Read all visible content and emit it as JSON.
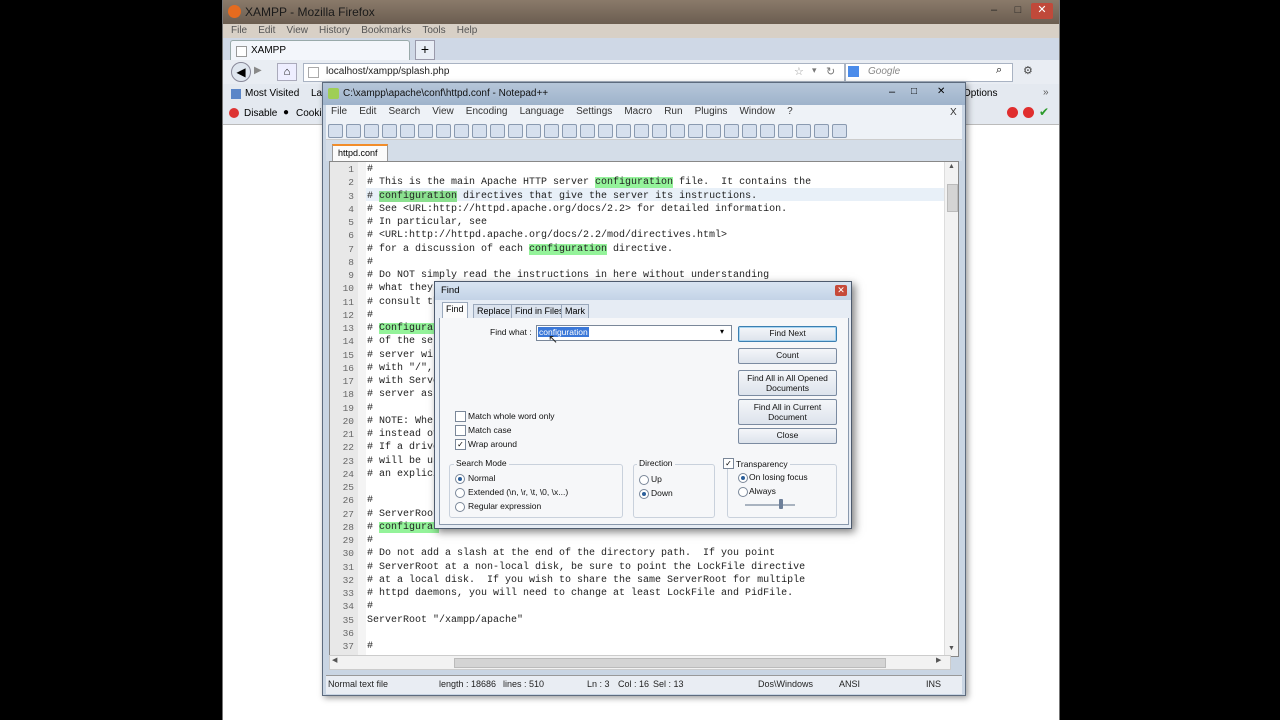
{
  "firefox": {
    "title": "XAMPP - Mozilla Firefox",
    "menu": [
      "File",
      "Edit",
      "View",
      "History",
      "Bookmarks",
      "Tools",
      "Help"
    ],
    "tab_label": "XAMPP",
    "new_tab_label": "+",
    "url": "localhost/xampp/splash.php",
    "search_placeholder": "Google",
    "bookmarks": [
      "Most Visited",
      "La"
    ],
    "addon_items": [
      "Disable",
      "Cooki"
    ],
    "addon_right": "Options"
  },
  "npp": {
    "title": "C:\\xampp\\apache\\conf\\httpd.conf - Notepad++",
    "menu": [
      "File",
      "Edit",
      "Search",
      "View",
      "Encoding",
      "Language",
      "Settings",
      "Macro",
      "Run",
      "Plugins",
      "Window",
      "?"
    ],
    "close_doc": "X",
    "tab_label": "httpd.conf",
    "lines": [
      {
        "n": "1",
        "t": "#"
      },
      {
        "n": "2",
        "t": "# This is the main Apache HTTP server configuration file.  It contains the"
      },
      {
        "n": "3",
        "t": "# configuration directives that give the server its instructions."
      },
      {
        "n": "4",
        "t": "# See <URL:http://httpd.apache.org/docs/2.2> for detailed information."
      },
      {
        "n": "5",
        "t": "# In particular, see"
      },
      {
        "n": "6",
        "t": "# <URL:http://httpd.apache.org/docs/2.2/mod/directives.html>"
      },
      {
        "n": "7",
        "t": "# for a discussion of each configuration directive."
      },
      {
        "n": "8",
        "t": "#"
      },
      {
        "n": "9",
        "t": "# Do NOT simply read the instructions in here without understanding"
      },
      {
        "n": "10",
        "t": "# what they"
      },
      {
        "n": "11",
        "t": "# consult th"
      },
      {
        "n": "12",
        "t": "#"
      },
      {
        "n": "13",
        "t": "# Configurat"
      },
      {
        "n": "14",
        "t": "# of the ser"
      },
      {
        "n": "15",
        "t": "# server wil"
      },
      {
        "n": "16",
        "t": "# with \"/\","
      },
      {
        "n": "17",
        "t": "# with Serve"
      },
      {
        "n": "18",
        "t": "# server as"
      },
      {
        "n": "19",
        "t": "#"
      },
      {
        "n": "20",
        "t": "# NOTE: Wher"
      },
      {
        "n": "21",
        "t": "# instead of"
      },
      {
        "n": "22",
        "t": "# If a drive"
      },
      {
        "n": "23",
        "t": "# will be us"
      },
      {
        "n": "24",
        "t": "# an explici"
      },
      {
        "n": "25",
        "t": ""
      },
      {
        "n": "26",
        "t": "#"
      },
      {
        "n": "27",
        "t": "# ServerRoot"
      },
      {
        "n": "28",
        "t": "# configurat"
      },
      {
        "n": "29",
        "t": "#"
      },
      {
        "n": "30",
        "t": "# Do not add a slash at the end of the directory path.  If you point"
      },
      {
        "n": "31",
        "t": "# ServerRoot at a non-local disk, be sure to point the LockFile directive"
      },
      {
        "n": "32",
        "t": "# at a local disk.  If you wish to share the same ServerRoot for multiple"
      },
      {
        "n": "33",
        "t": "# httpd daemons, you will need to change at least LockFile and PidFile."
      },
      {
        "n": "34",
        "t": "#"
      },
      {
        "n": "35",
        "t": "ServerRoot \"/xampp/apache\""
      },
      {
        "n": "36",
        "t": ""
      },
      {
        "n": "37",
        "t": "#"
      }
    ],
    "highlight_word": "configuration",
    "status": {
      "type": "Normal text file",
      "length": "length : 18686",
      "lines": "lines : 510",
      "ln": "Ln : 3",
      "col": "Col : 16",
      "sel": "Sel : 13",
      "eol": "Dos\\Windows",
      "enc": "ANSI",
      "mode": "INS"
    }
  },
  "find": {
    "title": "Find",
    "tabs": [
      "Find",
      "Replace",
      "Find in Files",
      "Mark"
    ],
    "find_what_label": "Find what :",
    "find_what_value": "configuration",
    "buttons": {
      "find_next": "Find Next",
      "count": "Count",
      "find_all_opened_1": "Find All in All Opened",
      "find_all_opened_2": "Documents",
      "find_all_current_1": "Find All in Current",
      "find_all_current_2": "Document",
      "close": "Close"
    },
    "options": {
      "whole_word": "Match whole word only",
      "match_case": "Match case",
      "wrap_around": "Wrap around"
    },
    "search_mode": {
      "title": "Search Mode",
      "normal": "Normal",
      "extended": "Extended (\\n, \\r, \\t, \\0, \\x...)",
      "regex": "Regular expression"
    },
    "direction": {
      "title": "Direction",
      "up": "Up",
      "down": "Down"
    },
    "transparency": {
      "title": "Transparency",
      "on_losing_focus": "On losing focus",
      "always": "Always"
    }
  }
}
